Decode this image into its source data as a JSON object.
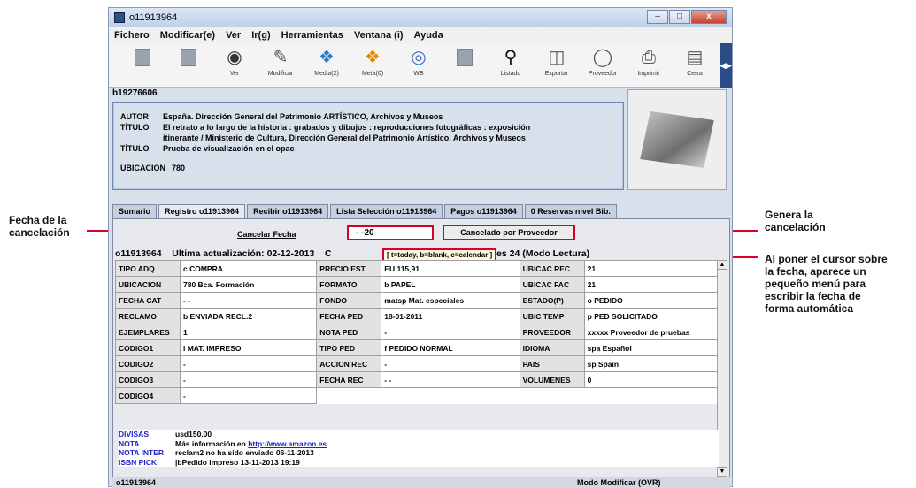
{
  "window": {
    "title": "o11913964",
    "btn_min": "–",
    "btn_max": "□",
    "btn_close": "x"
  },
  "menu": [
    "Fichero",
    "Modificar(e)",
    "Ver",
    "Ir(g)",
    "Herramientas",
    "Ventana (i)",
    "Ayuda"
  ],
  "toolbar": [
    {
      "label": "",
      "icon": "disabled-icon"
    },
    {
      "label": "",
      "icon": "disabled-icon"
    },
    {
      "label": "Ver",
      "icon": "view-icon"
    },
    {
      "label": "Modificar",
      "icon": "edit-icon"
    },
    {
      "label": "Media(2)",
      "icon": "media-icon"
    },
    {
      "label": "Meta(0)",
      "icon": "meta-icon"
    },
    {
      "label": "WB",
      "icon": "web-icon"
    },
    {
      "label": "",
      "icon": "disabled-icon"
    },
    {
      "label": "Listado",
      "icon": "search-icon"
    },
    {
      "label": "Exportar",
      "icon": "export-icon"
    },
    {
      "label": "Proveedor",
      "icon": "vendor-icon"
    },
    {
      "label": "Imprimir",
      "icon": "print-icon"
    },
    {
      "label": "Cerra",
      "icon": "close-doc-icon"
    }
  ],
  "record_id": "b19276606",
  "biblio": {
    "autor_label": "AUTOR",
    "autor": "España. Dirección General del Patrimonio ARTÍSTICO, Archivos y Museos",
    "titulo_label": "TÍTULO",
    "titulo1_l1": "El retrato a lo largo de la historia : grabados y dibujos : reproducciones fotográficas : exposición",
    "titulo1_l2": "itinerante / Ministerio de Cultura, Dirección General del Patrimonio Artístico, Archivos y Museos",
    "titulo2": "Prueba de visualización en el opac",
    "ubicacion_label": "UBICACION",
    "ubicacion": "780"
  },
  "tabs": [
    "Sumario",
    "Registro o11913964",
    "Recibir o11913964",
    "Lista Selección o11913964",
    "Pagos o11913964",
    "0 Reservas nivel Bib."
  ],
  "cancel": {
    "label": "Cancelar Fecha",
    "value": "- -20",
    "button": "Cancelado por Proveedor"
  },
  "status": {
    "id": "o11913964",
    "updated": "Ultima actualización: 02-12-2013",
    "c_prefix": "C",
    "revisions": "isiones 24 (Modo Lectura)"
  },
  "tooltip": "[ t=today, b=blank, c=calendar ]",
  "grid": [
    [
      "TIPO ADQ",
      "c  COMPRA",
      "PRECIO EST",
      "EU 115,91",
      "UBICAC REC",
      "21"
    ],
    [
      "UBICACION",
      "780   Bca. Formación",
      "FORMATO",
      "b  PAPEL",
      "UBICAC FAC",
      "21"
    ],
    [
      "FECHA CAT",
      "- -",
      "FONDO",
      "matsp  Mat. especiales",
      "ESTADO(P)",
      "o  PEDIDO"
    ],
    [
      "RECLAMO",
      "b  ENVIADA RECL.2",
      "FECHA PED",
      "18-01-2011",
      "UBIC TEMP",
      "p  PED SOLICITADO"
    ],
    [
      "EJEMPLARES",
      "1",
      "NOTA PED",
      "-",
      "PROVEEDOR",
      "xxxxx  Proveedor de pruebas"
    ],
    [
      "CODIGO1",
      "i  MAT. IMPRESO",
      "TIPO PED",
      "f  PEDIDO NORMAL",
      "IDIOMA",
      "spa  Español"
    ],
    [
      "CODIGO2",
      "-",
      "ACCION REC",
      "-",
      "PAIS",
      "sp  Spain"
    ],
    [
      "CODIGO3",
      "-",
      "FECHA REC",
      "- -",
      "VOLUMENES",
      "0"
    ],
    [
      "CODIGO4",
      "-",
      "",
      "",
      "",
      ""
    ]
  ],
  "notes": [
    {
      "k": "DIVISAS",
      "v": "usd150.00"
    },
    {
      "k": "NOTA",
      "v": "Más información en ",
      "link": "http://www.amazon.es"
    },
    {
      "k": "NOTA INTER",
      "v": "reclam2 no ha sido enviado    06-11-2013"
    },
    {
      "k": "ISBN PICK",
      "v": "|bPedido impreso 13-11-2013 19:19"
    }
  ],
  "footer": {
    "left": "o11913964",
    "right": "Modo Modificar (OVR)"
  },
  "annotations": {
    "left_l1": "Fecha de la",
    "left_l2": "cancelación",
    "right1_l1": "Genera la",
    "right1_l2": "cancelación",
    "right2_l1": "Al poner el cursor sobre",
    "right2_l2": "la fecha, aparece un",
    "right2_l3": "pequeño menú para",
    "right2_l4": "escribir la fecha de",
    "right2_l5": "forma automática"
  },
  "colors": {
    "highlight": "#d9002a",
    "link": "#1a23c8"
  }
}
